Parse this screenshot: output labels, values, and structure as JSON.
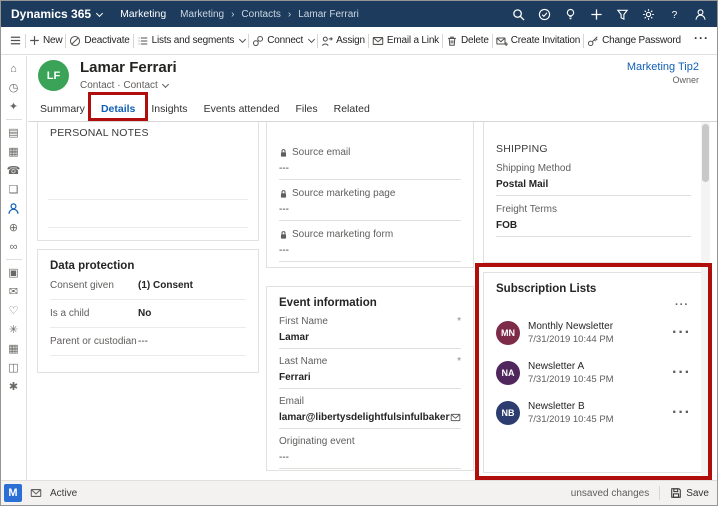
{
  "colors": {
    "accent": "#1160b7",
    "navbar": "#1d3b5c",
    "annotation": "#b00d0d",
    "header_avatar": "#3aa357",
    "m_tile": "#2b6fd6"
  },
  "topbar": {
    "brand": "Dynamics 365",
    "app": "Marketing",
    "crumbs": [
      "Marketing",
      "Contacts",
      "Lamar Ferrari"
    ],
    "crumb_sep": "›"
  },
  "commandbar": {
    "new": "New",
    "deactivate": "Deactivate",
    "lists_and_segments": "Lists and segments",
    "connect": "Connect",
    "assign": "Assign",
    "email_a_link": "Email a Link",
    "delete": "Delete",
    "create_invitation": "Create Invitation",
    "change_password": "Change Password",
    "more": "···"
  },
  "sidebar": {
    "icons": [
      {
        "name": "home",
        "glyph": "⌂"
      },
      {
        "name": "recent",
        "glyph": "◷"
      },
      {
        "name": "pinned",
        "glyph": "✦"
      },
      {
        "name": "my-work",
        "glyph": "▤"
      },
      {
        "name": "calendar",
        "glyph": "▦"
      },
      {
        "name": "phone-calls",
        "glyph": "☎"
      },
      {
        "name": "accounts",
        "glyph": "❏"
      },
      {
        "name": "contacts",
        "active": true
      },
      {
        "name": "leads",
        "glyph": "⊕"
      },
      {
        "name": "segments",
        "glyph": "∞"
      },
      {
        "name": "dashboards",
        "glyph": "▣"
      },
      {
        "name": "emails",
        "glyph": "✉"
      },
      {
        "name": "customer-journeys",
        "glyph": "♡"
      },
      {
        "name": "settings",
        "glyph": "✳"
      },
      {
        "name": "events",
        "glyph": "▦"
      },
      {
        "name": "marketing-forms",
        "glyph": "◫"
      },
      {
        "name": "marketing-pages",
        "glyph": "✱"
      }
    ]
  },
  "contact": {
    "initials": "LF",
    "name": "Lamar Ferrari",
    "subtitle": "Contact · Contact",
    "owner_name": "Marketing Tip2",
    "owner_role": "Owner"
  },
  "tabs": {
    "items": [
      "Summary",
      "Details",
      "Insights",
      "Events attended",
      "Files",
      "Related"
    ],
    "active": "Details"
  },
  "personal_notes": {
    "title": "PERSONAL NOTES"
  },
  "data_protection": {
    "title": "Data protection",
    "rows": [
      {
        "label": "Consent given",
        "value": "(1) Consent"
      },
      {
        "label": "Is a child",
        "value": "No"
      },
      {
        "label": "Parent or custodian",
        "value": "---"
      }
    ]
  },
  "source_info": {
    "fields": [
      {
        "label": "Source email",
        "value": "---"
      },
      {
        "label": "Source marketing page",
        "value": "---"
      },
      {
        "label": "Source marketing form",
        "value": "---"
      }
    ]
  },
  "event_information": {
    "title": "Event information",
    "fields": [
      {
        "label": "First Name",
        "value": "Lamar",
        "required": "*"
      },
      {
        "label": "Last Name",
        "value": "Ferrari",
        "required": "*"
      },
      {
        "label": "Email",
        "value": "lamar@libertysdelightfulsinfulbakeryandcaf"
      },
      {
        "label": "Originating event",
        "value": "---"
      }
    ]
  },
  "shipping": {
    "title": "SHIPPING",
    "fields": [
      {
        "label": "Shipping Method",
        "value": "Postal Mail"
      },
      {
        "label": "Freight Terms",
        "value": "FOB"
      }
    ]
  },
  "subscription_lists": {
    "title": "Subscription Lists",
    "more": "···",
    "items": [
      {
        "initials": "MN",
        "color": "#7e2a49",
        "name": "Monthly Newsletter",
        "date": "7/31/2019 10:44 PM",
        "more": "···"
      },
      {
        "initials": "NA",
        "color": "#50275d",
        "name": "Newsletter A",
        "date": "7/31/2019 10:45 PM",
        "more": "···"
      },
      {
        "initials": "NB",
        "color": "#2c3c6e",
        "name": "Newsletter B",
        "date": "7/31/2019 10:45 PM",
        "more": "···"
      }
    ]
  },
  "statusbar": {
    "tile": "M",
    "status": "Active",
    "unsaved": "unsaved changes",
    "save": "Save"
  }
}
